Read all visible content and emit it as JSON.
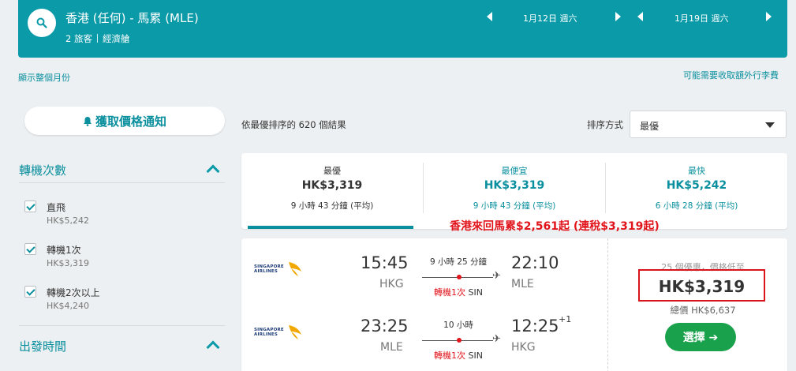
{
  "header": {
    "route": "香港 (任何) - 馬累 (MLE)",
    "travelers": "2 旅客",
    "cabin": "經濟艙",
    "depart_date": "1月12日 週六",
    "return_date": "1月19日 週六"
  },
  "links": {
    "show_month": "顯示整個月份",
    "baggage_fees": "可能需要收取額外行李費"
  },
  "price_alert": {
    "label": "獲取價格通知",
    "icon": "bell-icon"
  },
  "filters": {
    "stops": {
      "title": "轉機次數",
      "options": [
        {
          "label": "直飛",
          "price": "HK$5,242",
          "checked": true
        },
        {
          "label": "轉機1次",
          "price": "HK$3,319",
          "checked": true
        },
        {
          "label": "轉機2次以上",
          "price": "HK$4,240",
          "checked": true
        }
      ]
    },
    "departure_time": {
      "title": "出發時間"
    }
  },
  "sort": {
    "results_text": "依最優排序的 620 個結果",
    "label": "排序方式",
    "value": "最優"
  },
  "tabs": [
    {
      "title": "最優",
      "price": "HK$3,319",
      "duration": "9 小時 43 分鐘 (平均)",
      "active": true
    },
    {
      "title": "最便宜",
      "price": "HK$3,319",
      "duration": "9 小時 43 分鐘 (平均)",
      "active": false
    },
    {
      "title": "最快",
      "price": "HK$5,242",
      "duration": "6 小時 28 分鐘 (平均)",
      "active": false
    }
  ],
  "annotation": "香港來回馬累$2,561起 (連稅$3,319起)",
  "result": {
    "airline_logo_text": "SINGAPORE AIRLINES",
    "outbound": {
      "depart_time": "15:45",
      "depart_airport": "HKG",
      "arrive_time": "22:10",
      "arrive_airport": "MLE",
      "duration": "9 小時 25 分鐘",
      "stops": "轉機1次",
      "via": "SIN"
    },
    "return": {
      "depart_time": "23:25",
      "depart_airport": "MLE",
      "arrive_time": "12:25",
      "arrive_airport": "HKG",
      "day_offset": "+1",
      "duration": "10 小時",
      "stops": "轉機1次",
      "via": "SIN"
    },
    "deals_text": "25 個優惠，價格低至",
    "price": "HK$3,319",
    "total": "總價 HK$6,637",
    "select_label": "選擇 ➔"
  },
  "colors": {
    "teal": "#0a9aa8",
    "accent_red": "#e1141b",
    "select_green": "#1aa14b"
  }
}
